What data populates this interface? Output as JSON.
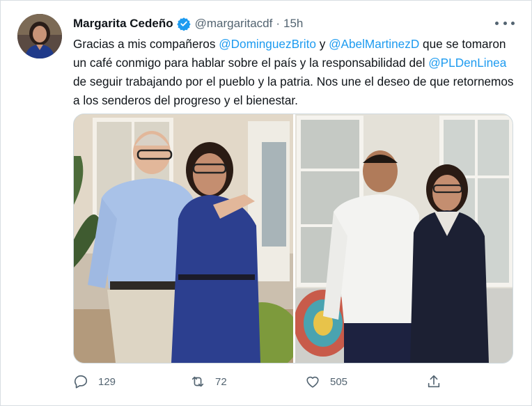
{
  "tweet": {
    "author_name": "Margarita Cedeño",
    "handle": "@margaritacdf",
    "separator": "·",
    "time": "15h",
    "text": {
      "p1": "Gracias a mis compañeros ",
      "m1": "@DominguezBrito",
      "p2": " y ",
      "m2": "@AbelMartinezD",
      "p3": " que se tomaron un café conmigo para hablar sobre el país y la responsabilidad  del ",
      "m3": "@PLDenLinea",
      "p4": " de seguir trabajando por el pueblo y la patria. Nos une el deseo de que retornemos a los senderos del progreso y el bienestar."
    }
  },
  "actions": {
    "replies": "129",
    "retweets": "72",
    "likes": "505"
  },
  "icons": {
    "verified": "verified-badge-icon",
    "more": "more-options-icon",
    "reply": "reply-icon",
    "retweet": "retweet-icon",
    "like": "heart-icon",
    "share": "share-icon"
  },
  "colors": {
    "link": "#1d9bf0",
    "secondary_text": "#536471",
    "verified": "#1d9bf0"
  }
}
